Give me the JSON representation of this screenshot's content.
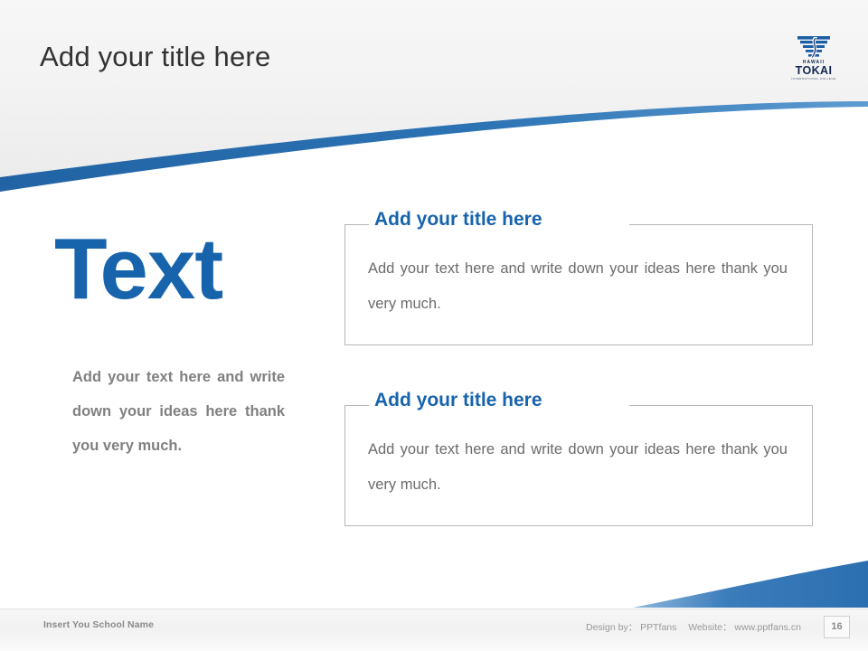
{
  "header": {
    "title": "Add your title here"
  },
  "logo": {
    "name": "hawaii-tokai-logo",
    "line_top": "HAWAII",
    "line_main": "TOKAI",
    "line_sub": "INTERNATIONAL COLLEGE"
  },
  "left": {
    "big_word": "Text",
    "body": "Add your text here and write down your ideas here thank you very much."
  },
  "panels": [
    {
      "title": "Add your title here",
      "body": "Add your text here and write down your ideas here thank you very much."
    },
    {
      "title": "Add your title here",
      "body": "Add your text here and write down your ideas here thank you very much."
    }
  ],
  "footer": {
    "school": "Insert You School Name",
    "design_by": "Design by： PPTfans",
    "website": "Website： www.pptfans.cn",
    "page_number": "16"
  },
  "colors": {
    "accent_blue": "#1764AC",
    "swoosh_blue": "#2C6FB0",
    "title_gray": "#333333",
    "body_gray": "#6B6B6B",
    "left_body_gray": "#808080",
    "footer_gray": "#9A9A9A",
    "border_gray": "#B6B6B6"
  }
}
